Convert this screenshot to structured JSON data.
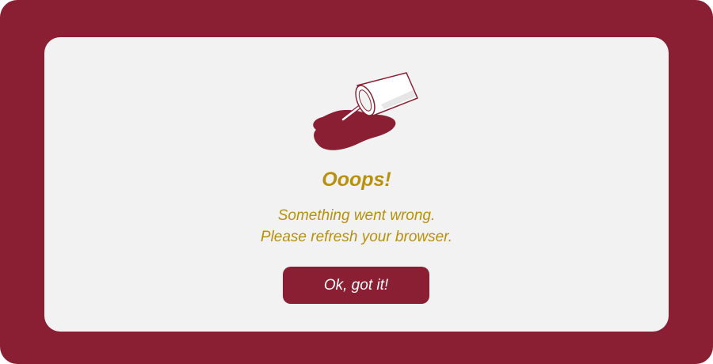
{
  "dialog": {
    "title": "Ooops!",
    "message_line1": "Something went wrong.",
    "message_line2": "Please refresh your browser.",
    "button_label": "Ok, got it!"
  },
  "illustration": {
    "icon": "spilled-drink-icon"
  },
  "colors": {
    "frame_background": "#8a1f33",
    "card_background": "#f2f2f2",
    "text_accent": "#b8900b",
    "button_background": "#8a1f33",
    "button_text": "#ffffff"
  }
}
